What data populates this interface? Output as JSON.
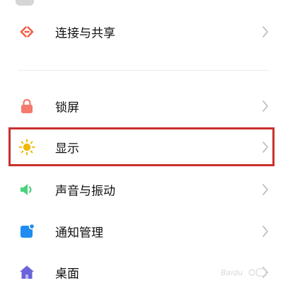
{
  "settings": {
    "items": [
      {
        "label": "连接与共享",
        "icon": "connection-icon",
        "icon_color": "#f05a41"
      },
      {
        "label": "锁屏",
        "icon": "lock-icon",
        "icon_color": "#f37a6c"
      },
      {
        "label": "显示",
        "icon": "sun-icon",
        "icon_color": "#f2b705",
        "highlighted": true
      },
      {
        "label": "声音与振动",
        "icon": "speaker-icon",
        "icon_color": "#4ad27c"
      },
      {
        "label": "通知管理",
        "icon": "notification-icon",
        "icon_color": "#1e8cf0"
      },
      {
        "label": "桌面",
        "icon": "home-icon",
        "icon_color": "#6b63d9"
      }
    ]
  },
  "annotation": {
    "highlight_color": "#c9302c"
  }
}
